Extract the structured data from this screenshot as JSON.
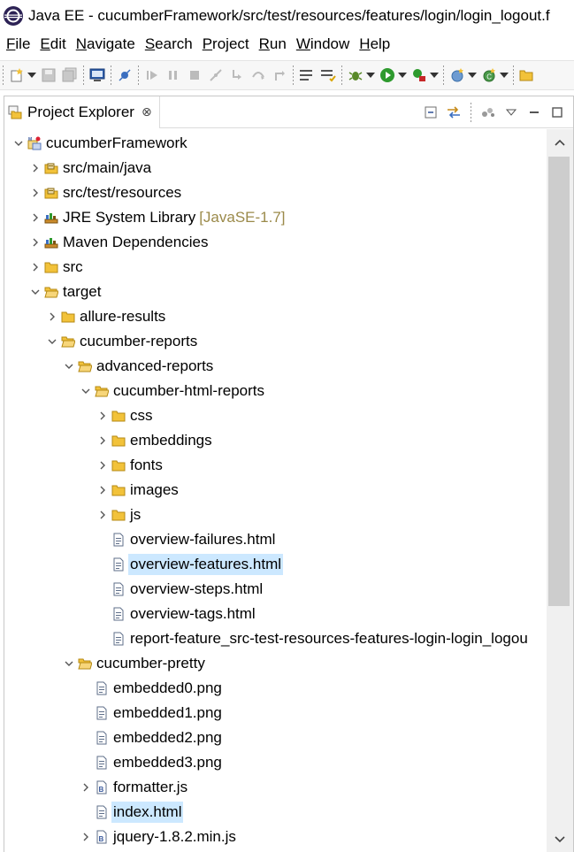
{
  "window": {
    "title": "Java EE - cucumberFramework/src/test/resources/features/login/login_logout.f"
  },
  "menu": [
    {
      "mnemonic": "F",
      "rest": "ile"
    },
    {
      "mnemonic": "E",
      "rest": "dit"
    },
    {
      "mnemonic": "N",
      "rest": "avigate"
    },
    {
      "mnemonic": "S",
      "rest": "earch"
    },
    {
      "mnemonic": "P",
      "rest": "roject"
    },
    {
      "mnemonic": "R",
      "rest": "un"
    },
    {
      "mnemonic": "W",
      "rest": "indow"
    },
    {
      "mnemonic": "H",
      "rest": "elp"
    }
  ],
  "view": {
    "tab_label": "Project Explorer",
    "tab_close": "⊗"
  },
  "tree": {
    "selected_color": "#cce8ff",
    "nodes": [
      {
        "label": "cucumberFramework",
        "icon": "maven-project-icon",
        "expanded": true
      },
      {
        "label": "src/main/java",
        "icon": "source-folder-icon",
        "expanded": false
      },
      {
        "label": "src/test/resources",
        "icon": "source-folder-icon",
        "expanded": false
      },
      {
        "label": "JRE System Library",
        "decoration": "[JavaSE-1.7]",
        "icon": "library-icon",
        "expanded": false
      },
      {
        "label": "Maven Dependencies",
        "icon": "library-icon",
        "expanded": false
      },
      {
        "label": "src",
        "icon": "folder-icon",
        "expanded": false
      },
      {
        "label": "target",
        "icon": "folder-open-icon",
        "expanded": true
      },
      {
        "label": "allure-results",
        "icon": "folder-icon",
        "expanded": false
      },
      {
        "label": "cucumber-reports",
        "icon": "folder-open-icon",
        "expanded": true
      },
      {
        "label": "advanced-reports",
        "icon": "folder-open-icon",
        "expanded": true
      },
      {
        "label": "cucumber-html-reports",
        "icon": "folder-open-icon",
        "expanded": true
      },
      {
        "label": "css",
        "icon": "folder-icon",
        "expanded": false
      },
      {
        "label": "embeddings",
        "icon": "folder-icon",
        "expanded": false
      },
      {
        "label": "fonts",
        "icon": "folder-icon",
        "expanded": false
      },
      {
        "label": "images",
        "icon": "folder-icon",
        "expanded": false
      },
      {
        "label": "js",
        "icon": "folder-icon",
        "expanded": false
      },
      {
        "label": "overview-failures.html",
        "icon": "file-icon"
      },
      {
        "label": "overview-features.html",
        "icon": "file-icon",
        "selected": true
      },
      {
        "label": "overview-steps.html",
        "icon": "file-icon"
      },
      {
        "label": "overview-tags.html",
        "icon": "file-icon"
      },
      {
        "label": "report-feature_src-test-resources-features-login-login_logou",
        "icon": "file-icon"
      },
      {
        "label": "cucumber-pretty",
        "icon": "folder-open-icon",
        "expanded": true
      },
      {
        "label": "embedded0.png",
        "icon": "file-icon"
      },
      {
        "label": "embedded1.png",
        "icon": "file-icon"
      },
      {
        "label": "embedded2.png",
        "icon": "file-icon"
      },
      {
        "label": "embedded3.png",
        "icon": "file-icon"
      },
      {
        "label": "formatter.js",
        "icon": "js-file-icon",
        "expanded": false
      },
      {
        "label": "index.html",
        "icon": "file-icon",
        "selected": true
      },
      {
        "label": "jquery-1.8.2.min.js",
        "icon": "js-file-icon",
        "expanded": false
      }
    ]
  }
}
